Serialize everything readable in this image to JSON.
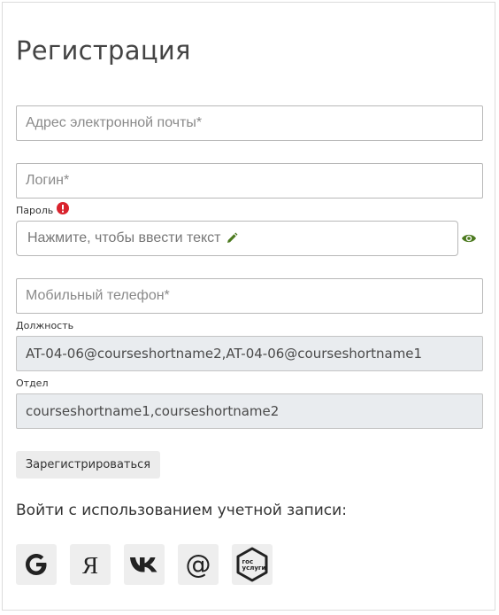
{
  "form": {
    "title": "Регистрация",
    "email_placeholder": "Адрес электронной почты*",
    "login_placeholder": "Логин*",
    "password_label": "Пароль",
    "password_placeholder": "Нажмите, чтобы ввести текст",
    "phone_placeholder": "Мобильный телефон*",
    "position_label": "Должность",
    "position_value": "AT-04-06@courseshortname2,AT-04-06@courseshortname1",
    "department_label": "Отдел",
    "department_value": "courseshortname1,courseshortname2",
    "submit_label": "Зарегистрироваться"
  },
  "social": {
    "title": "Войти с использованием учетной записи:",
    "providers": [
      "google",
      "yandex",
      "vk",
      "mail-ru",
      "gosuslugi"
    ],
    "gosuslugi_text": [
      "гос",
      "услуги"
    ]
  },
  "colors": {
    "error": "#d9232d",
    "pencil": "#4c7a1f",
    "eye": "#4c7a1f"
  }
}
